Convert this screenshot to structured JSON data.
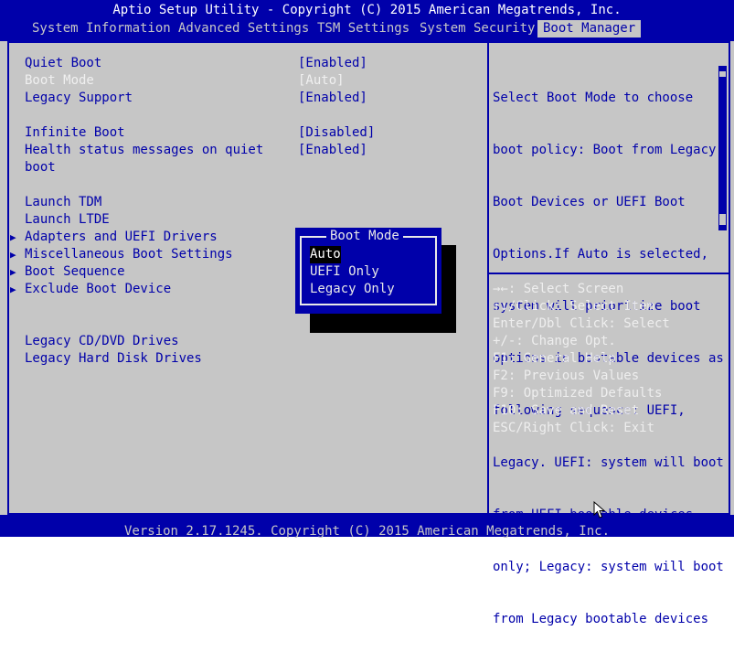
{
  "window": {
    "title": "Aptio Setup Utility - Copyright (C) 2015 American Megatrends, Inc.",
    "footer": "Version 2.17.1245. Copyright (C) 2015 American Megatrends, Inc."
  },
  "tabs": [
    {
      "label": "System Information",
      "active": false
    },
    {
      "label": "Advanced Settings",
      "active": false
    },
    {
      "label": "TSM Settings",
      "active": false
    },
    {
      "label": "System Security",
      "active": false
    },
    {
      "label": "Boot Manager",
      "active": true
    }
  ],
  "settings": [
    {
      "label": "Quiet Boot",
      "value": "[Enabled]"
    },
    {
      "label": "Boot Mode",
      "value": "[Auto]"
    },
    {
      "label": "Legacy Support",
      "value": "[Enabled]"
    },
    {
      "label": "Infinite Boot",
      "value": "[Disabled]"
    },
    {
      "label": "Health status messages on quiet",
      "label2": "boot",
      "value": "[Enabled]"
    },
    {
      "label": "Launch TDM"
    },
    {
      "label": "Launch LTDE"
    },
    {
      "label": "Adapters and UEFI Drivers",
      "submenu": true
    },
    {
      "label": "Miscellaneous Boot Settings",
      "submenu": true
    },
    {
      "label": "Boot Sequence",
      "submenu": true
    },
    {
      "label": "Exclude Boot Device",
      "submenu": true
    },
    {
      "label": "Legacy CD/DVD Drives"
    },
    {
      "label": "Legacy Hard Disk Drives"
    }
  ],
  "submenu_arrow": "▶",
  "help": {
    "lines": [
      "Select Boot Mode to choose",
      "boot policy: Boot from Legacy",
      "Boot Devices or UEFI Boot",
      "Options.If Auto is selected,",
      "system will prioritize boot",
      "options in bootable devices as",
      "following sequence: UEFI,",
      "Legacy. UEFI: system will boot",
      "from UEFI bootable devices",
      "only; Legacy: system will boot",
      "from Legacy bootable devices"
    ]
  },
  "keys": [
    "→←: Select Screen",
    "↑↓/Click: Select Item",
    "Enter/Dbl Click: Select",
    "+/-: Change Opt.",
    "F1: General Help",
    "F2: Previous Values",
    "F9: Optimized Defaults",
    "F10: Save and Reset",
    "ESC/Right Click: Exit"
  ],
  "popup": {
    "title": "Boot Mode",
    "options": [
      {
        "label": "Auto",
        "selected": true
      },
      {
        "label": "UEFI Only",
        "selected": false
      },
      {
        "label": "Legacy Only",
        "selected": false
      }
    ]
  },
  "colors": {
    "background": "#c6c6c6",
    "accent": "#0000aa",
    "highlight_text": "#ffffff"
  }
}
